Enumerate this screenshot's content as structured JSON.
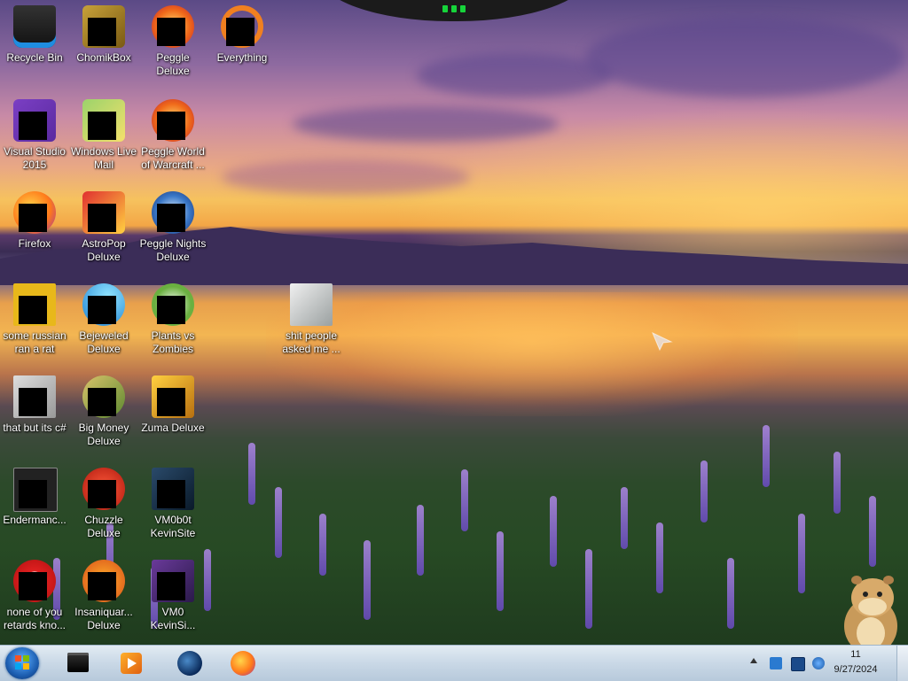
{
  "desktop": {
    "icons": [
      {
        "id": "recycle-bin",
        "label": "Recycle Bin"
      },
      {
        "id": "chomikbox",
        "label": "ChomikBox"
      },
      {
        "id": "peggle-deluxe",
        "label": "Peggle Deluxe"
      },
      {
        "id": "everything",
        "label": "Everything"
      },
      {
        "id": "visual-studio",
        "label": "Visual Studio 2015"
      },
      {
        "id": "windows-live-mail",
        "label": "Windows Live Mail"
      },
      {
        "id": "peggle-wow",
        "label": "Peggle World of Warcraft ..."
      },
      {
        "id": "firefox",
        "label": "Firefox"
      },
      {
        "id": "astropop",
        "label": "AstroPop Deluxe"
      },
      {
        "id": "peggle-nights",
        "label": "Peggle Nights Deluxe"
      },
      {
        "id": "russian-rat",
        "label": "some russian ran a rat"
      },
      {
        "id": "bejeweled",
        "label": "Bejeweled Deluxe"
      },
      {
        "id": "plants-vs-zombies",
        "label": "Plants vs Zombies"
      },
      {
        "id": "people-asked-folder",
        "label": "shit people asked me ..."
      },
      {
        "id": "that-but-csharp",
        "label": "that but its c#"
      },
      {
        "id": "big-money",
        "label": "Big Money Deluxe"
      },
      {
        "id": "zuma",
        "label": "Zuma Deluxe"
      },
      {
        "id": "endermanch",
        "label": "Endermanc..."
      },
      {
        "id": "chuzzle",
        "label": "Chuzzle Deluxe"
      },
      {
        "id": "vm0b0t-kevinsite",
        "label": "VM0b0t KevinSite"
      },
      {
        "id": "none-of-you",
        "label": "none of you retards kno..."
      },
      {
        "id": "insaniquarium",
        "label": "Insaniquar... Deluxe"
      },
      {
        "id": "vm0-kevinsi",
        "label": "VM0 KevinSi..."
      }
    ]
  },
  "taskbar": {
    "clock_time": "11",
    "clock_date": "9/27/2024",
    "pinned": [
      "file-manager-icon",
      "media-player-icon",
      "globe-browser-icon",
      "firefox-icon"
    ]
  },
  "colors": {
    "taskbar_top": "#e2ebf3",
    "taskbar_bottom": "#b7c9db",
    "led_green": "#16d43a"
  }
}
